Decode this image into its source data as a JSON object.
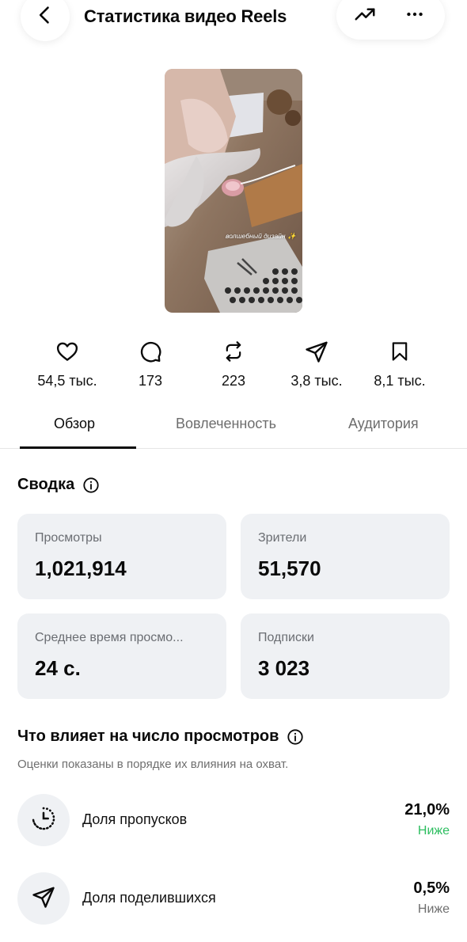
{
  "header": {
    "title": "Статистика видео Reels",
    "back_icon": "chevron-left-icon",
    "trend_icon": "trending-up-icon",
    "more_icon": "more-horizontal-icon"
  },
  "thumbnail": {
    "caption": "волшебный дизайн ✨"
  },
  "stats": [
    {
      "icon": "heart-icon",
      "value": "54,5 тыс."
    },
    {
      "icon": "comment-icon",
      "value": "173"
    },
    {
      "icon": "repost-icon",
      "value": "223"
    },
    {
      "icon": "share-icon",
      "value": "3,8 тыс."
    },
    {
      "icon": "bookmark-icon",
      "value": "8,1 тыс."
    }
  ],
  "tabs": [
    {
      "label": "Обзор",
      "active": true
    },
    {
      "label": "Вовлеченность",
      "active": false
    },
    {
      "label": "Аудитория",
      "active": false
    }
  ],
  "summary": {
    "title": "Сводка",
    "cards": [
      {
        "label": "Просмотры",
        "value": "1,021,914"
      },
      {
        "label": "Зрители",
        "value": "51,570"
      },
      {
        "label": "Среднее время просмо...",
        "value": "24 с."
      },
      {
        "label": "Подписки",
        "value": "3 023"
      }
    ]
  },
  "factors": {
    "title": "Что влияет на число просмотров",
    "subtitle": "Оценки показаны в порядке их влияния на охват.",
    "items": [
      {
        "icon": "skip-timer-icon",
        "label": "Доля пропусков",
        "percent": "21,0%",
        "trend": "Ниже",
        "trend_color": "#2dbe60"
      },
      {
        "icon": "share-icon",
        "label": "Доля поделившихся",
        "percent": "0,5%",
        "trend": "Ниже",
        "trend_color": "#6f6f6f"
      }
    ]
  }
}
